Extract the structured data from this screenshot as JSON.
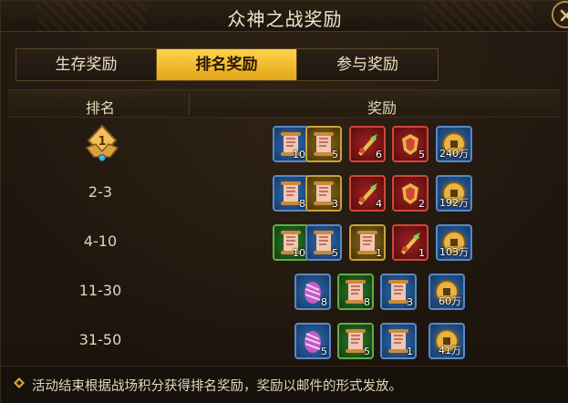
{
  "window": {
    "title": "众神之战奖励"
  },
  "tabs": [
    {
      "label": "生存奖励",
      "active": false
    },
    {
      "label": "排名奖励",
      "active": true
    },
    {
      "label": "参与奖励",
      "active": false
    }
  ],
  "table": {
    "headers": {
      "rank": "排名",
      "reward": "奖励"
    },
    "rows": [
      {
        "rank": "",
        "medal": "1",
        "rewards": [
          {
            "icon": "scroll-icon",
            "frame": "blue",
            "qty": "10"
          },
          {
            "icon": "scroll-icon",
            "frame": "gold",
            "qty": "5"
          },
          {
            "icon": "weapon-shard-icon",
            "frame": "red",
            "qty": "6"
          },
          {
            "icon": "armor-shard-icon",
            "frame": "red",
            "qty": "5"
          },
          {
            "icon": "gold-coin-icon",
            "frame": "blue",
            "qty": "240万"
          }
        ]
      },
      {
        "rank": "2-3",
        "rewards": [
          {
            "icon": "scroll-icon",
            "frame": "blue",
            "qty": "8"
          },
          {
            "icon": "scroll-icon",
            "frame": "gold",
            "qty": "3"
          },
          {
            "icon": "weapon-shard-icon",
            "frame": "red",
            "qty": "4"
          },
          {
            "icon": "armor-shard-icon",
            "frame": "red",
            "qty": "2"
          },
          {
            "icon": "gold-coin-icon",
            "frame": "blue",
            "qty": "192万"
          }
        ]
      },
      {
        "rank": "4-10",
        "rewards": [
          {
            "icon": "scroll-icon",
            "frame": "green",
            "qty": "10"
          },
          {
            "icon": "scroll-icon",
            "frame": "blue",
            "qty": "5"
          },
          {
            "icon": "scroll-icon",
            "frame": "gold",
            "qty": "1"
          },
          {
            "icon": "weapon-shard-icon",
            "frame": "red",
            "qty": "1"
          },
          {
            "icon": "gold-coin-icon",
            "frame": "blue",
            "qty": "103万"
          }
        ]
      },
      {
        "rank": "11-30",
        "rewards": [
          {
            "icon": "egg-icon",
            "frame": "blue",
            "qty": "8"
          },
          {
            "icon": "scroll-icon",
            "frame": "green",
            "qty": "8"
          },
          {
            "icon": "scroll-icon",
            "frame": "blue",
            "qty": "3"
          },
          {
            "icon": "gold-coin-icon",
            "frame": "blue",
            "qty": "60万"
          }
        ]
      },
      {
        "rank": "31-50",
        "rewards": [
          {
            "icon": "egg-icon",
            "frame": "blue",
            "qty": "5"
          },
          {
            "icon": "scroll-icon",
            "frame": "green",
            "qty": "5"
          },
          {
            "icon": "scroll-icon",
            "frame": "blue",
            "qty": "1"
          },
          {
            "icon": "gold-coin-icon",
            "frame": "blue",
            "qty": "41万"
          }
        ]
      }
    ]
  },
  "footer": {
    "icon": "diamond-bullet-icon",
    "text": "活动结束根据战场积分获得排名奖励，奖励以邮件的形式发放。"
  },
  "colors": {
    "accent": "#f5c233",
    "background": "#1b140d",
    "text": "#e3d6b8"
  }
}
